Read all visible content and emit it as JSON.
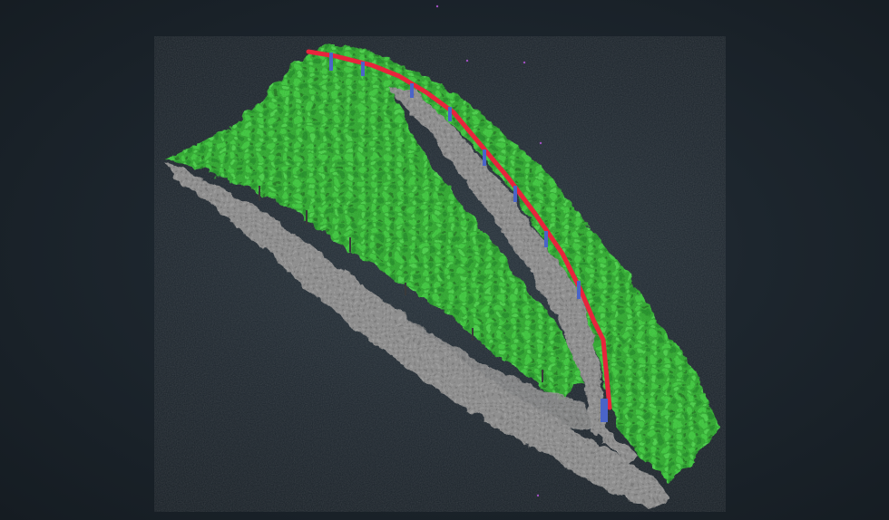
{
  "scene": {
    "kind": "lidar-point-cloud",
    "classes": [
      {
        "name": "vegetation",
        "color": "#2db52d"
      },
      {
        "name": "ground",
        "color": "#8a8a8a"
      },
      {
        "name": "power-line",
        "color": "#e8243c"
      },
      {
        "name": "pole",
        "color": "#4a64c8"
      }
    ],
    "background_color": "#1d262e"
  }
}
